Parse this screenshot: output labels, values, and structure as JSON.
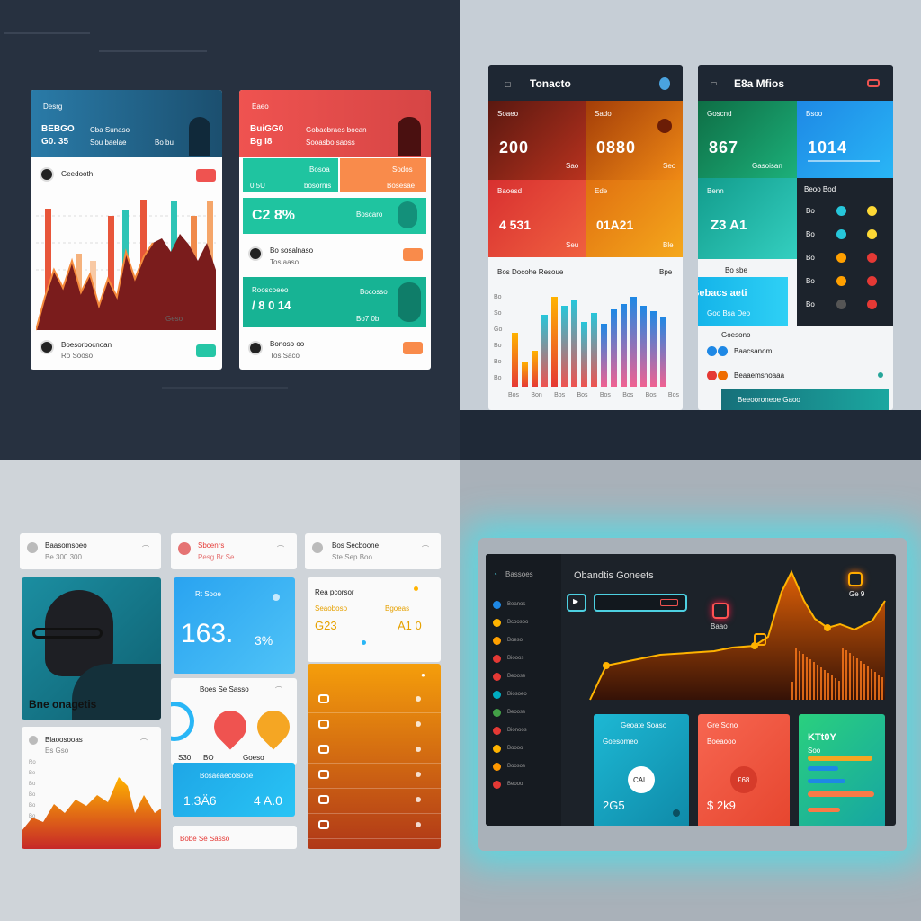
{
  "q1": {
    "left_card": {
      "header_title": "Desrg",
      "header_line1": "BEBGO",
      "header_line1b": "Cba Sunaso",
      "header_line2": "G0. 35",
      "header_line2b": "Sou baelae",
      "header_tag": "Bo bu",
      "user_top": "Geedooth",
      "user_bottom": "Boesorbocnoan",
      "user_bottom_sub": "Ro Sooso",
      "chart_label": "Geso"
    },
    "right_card": {
      "header_title": "Eaeo",
      "header_line1": "BuiGG0",
      "header_line1b": "Gobacbraes bocan",
      "header_line2": "Bg I8",
      "header_line2b": "Sooasbo saoss",
      "tile_a": "Bosoa",
      "tile_a_sub": "0.5U",
      "tile_a_sub2": "bosornis",
      "tile_b": "Sodos",
      "tile_b_sub": "Bosesae",
      "stat1_value": "C2 8%",
      "stat1_label": "Boscaro",
      "row1_title": "Bo sosalnaso",
      "row1_sub": "Tos aaso",
      "stat2_title": "Rooscoeeo",
      "stat2_value": "/ 8 0 14",
      "stat2_label": "Bocosso",
      "stat2_sub": "Bo7 0b",
      "row2_title": "Bonoso oo",
      "row2_sub": "Tos Saco"
    }
  },
  "q2": {
    "left_panel": {
      "title": "Tonacto",
      "tiles": [
        {
          "label": "Soaeo",
          "value": "200",
          "sub": "Sao",
          "color": "#8a1f14"
        },
        {
          "label": "Sado",
          "value": "0880",
          "sub": "Seo",
          "color": "#d9620b"
        },
        {
          "label": "Baoesd",
          "value": "4 531",
          "sub": "Seu",
          "color": "#d9342b"
        },
        {
          "label": "Ede",
          "value": "01A21",
          "sub": "Ble",
          "color": "#e9830d"
        }
      ],
      "chart_title": "Bos Docohe Resoue",
      "chart_tag": "Bpe",
      "y_ticks": [
        "Bo",
        "So",
        "Go",
        "Bo",
        "Bo",
        "Bo",
        "So"
      ],
      "x_ticks": [
        "Bos",
        "Bon",
        "Bos",
        "Bos",
        "Bos",
        "Bos",
        "Bos",
        "Bos"
      ]
    },
    "right_panel": {
      "title": "E8a Mfios",
      "tiles": [
        {
          "label": "Goscnd",
          "value": "867",
          "sub": "Gasoisan",
          "color": "#138b5c"
        },
        {
          "label": "Bsoo",
          "value": "1014",
          "sub": "",
          "color": "#2096e6"
        },
        {
          "label": "Benn",
          "value": "Z3 A1",
          "sub": "",
          "color": "#1aa39c"
        }
      ],
      "legend_title": "Beoo Bod",
      "legend_rows": [
        "Bo",
        "Bo",
        "Bo",
        "Bo",
        "Bo"
      ],
      "section_title": "Bo sbe",
      "highlight_value": "Sebacs aeti",
      "highlight_sub": "Goo Bsa Deo",
      "list_header": "Goesono",
      "list_rows": [
        "Baacsanom",
        "Beaaemsnoaaa"
      ],
      "footer_button": "Beeooroneoe Gaoo"
    }
  },
  "q3": {
    "top_cards": [
      {
        "title": "Baasomsoeo",
        "sub": "Be 300 300"
      },
      {
        "title": "Sbcenrs",
        "sub": "Pesg Br Se"
      },
      {
        "title": "Bos Secboone",
        "sub": "Ste Sep Boo"
      }
    ],
    "portrait_caption": "Bne onagetis",
    "area_card": {
      "title": "Blaoosooas",
      "sub": "Es Gso",
      "ticks": [
        "Ro",
        "Be",
        "Bo",
        "Bo",
        "Bo",
        "Bo"
      ]
    },
    "blue_card": {
      "label": "Rt Sooe",
      "value": "163.",
      "pct": "3%"
    },
    "mid_card": {
      "title": "Boes Se Sasso",
      "labels": [
        "S30",
        "BO",
        "Goeso"
      ]
    },
    "small_blue_card": {
      "title": "Bosaeaecolsooe",
      "value": "1.3Ä6",
      "value2": "4 A.0"
    },
    "footer_card": {
      "title": "Bobe Se Sasso"
    },
    "list_card": {
      "title": "Rea pcorsor",
      "col1": "Seaoboso",
      "col2": "Bgoeas",
      "v1": "G23",
      "v2": "A1 0"
    },
    "orange_panel_rows": [
      "",
      "",
      "",
      "",
      "",
      ""
    ]
  },
  "q4": {
    "title": "Obandtis Goneets",
    "sidebar_label": "Bassoes",
    "sidebar_rows": [
      "Beanos",
      "Bcoosoo",
      "Boeso",
      "Biooos",
      "Beoose",
      "Biosoeo",
      "Beooss",
      "Bionoos",
      "Boooo",
      "Boosos",
      "Beooo"
    ],
    "sidebar_colors": [
      "#1e88e5",
      "#ffb300",
      "#ffa000",
      "#e53935",
      "#e53935",
      "#00acc1",
      "#43a047",
      "#e53935",
      "#ffb300",
      "#ff9800",
      "#e53935"
    ],
    "search_placeholder": "",
    "chip": "Ge 9",
    "marker_label": "Baao",
    "marker2": "",
    "teal_card": {
      "title": "Geoate Soaso",
      "sub": "Goesomeo",
      "circle": "CAl",
      "value": "2G5"
    },
    "red_card": {
      "title": "Gre Sono",
      "sub": "Boeaooo",
      "circle": "£68",
      "value": "$ 2k9"
    },
    "green_card": {
      "title": "KTt0Y",
      "sub": "Soo"
    }
  },
  "colors": {
    "teal": "#14b8a6",
    "orange": "#f97316",
    "red": "#ef4444",
    "blue": "#2196f3"
  }
}
